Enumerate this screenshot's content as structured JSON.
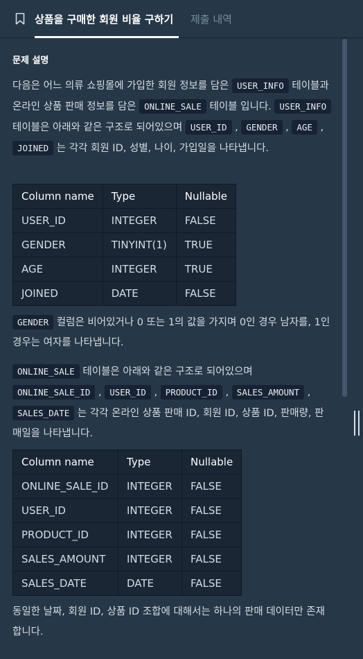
{
  "tabs": {
    "active_label": "상품을 구매한 회원 비율 구하기",
    "inactive_label": "제출 내역",
    "icon": "bookmark-icon"
  },
  "section_title": "문제 설명",
  "para1": {
    "t1": "다음은 어느 의류 쇼핑몰에 가입한 회원 정보를 담은 ",
    "c1": "USER_INFO",
    "t2": " 테이블과 온라인 상품 판매 정보를 담은 ",
    "c2": "ONLINE_SALE",
    "t3": " 테이블 입니다. ",
    "c3": "USER_INFO",
    "t4": " 테이블은 아래와 같은 구조로 되어있으며 ",
    "c4": "USER_ID",
    "t5": " , ",
    "c5": "GENDER",
    "t6": " , ",
    "c6": "AGE",
    "t7": " , ",
    "c7": "JOINED",
    "t8": " 는 각각 회원 ID, 성별, 나이, 가입일을 나타냅니다."
  },
  "table1": {
    "headers": [
      "Column name",
      "Type",
      "Nullable"
    ],
    "rows": [
      [
        "USER_ID",
        "INTEGER",
        "FALSE"
      ],
      [
        "GENDER",
        "TINYINT(1)",
        "TRUE"
      ],
      [
        "AGE",
        "INTEGER",
        "TRUE"
      ],
      [
        "JOINED",
        "DATE",
        "FALSE"
      ]
    ]
  },
  "para2": {
    "c1": "GENDER",
    "t1": " 컬럼은 비어있거나 0 또는 1의 값을 가지며 0인 경우 남자를, 1인 경우는 여자를 나타냅니다."
  },
  "para3": {
    "c1": "ONLINE_SALE",
    "t1": " 테이블은 아래와 같은 구조로 되어있으며 ",
    "c2": "ONLINE_SALE_ID",
    "t2": " , ",
    "c3": "USER_ID",
    "t3": " , ",
    "c4": "PRODUCT_ID",
    "t4": " , ",
    "c5": "SALES_AMOUNT",
    "t5": " , ",
    "c6": "SALES_DATE",
    "t6": " 는 각각 온라인 상품 판매 ID, 회원 ID, 상품 ID, 판매량, 판매일을 나타냅니다."
  },
  "table2": {
    "headers": [
      "Column name",
      "Type",
      "Nullable"
    ],
    "rows": [
      [
        "ONLINE_SALE_ID",
        "INTEGER",
        "FALSE"
      ],
      [
        "USER_ID",
        "INTEGER",
        "FALSE"
      ],
      [
        "PRODUCT_ID",
        "INTEGER",
        "FALSE"
      ],
      [
        "SALES_AMOUNT",
        "INTEGER",
        "FALSE"
      ],
      [
        "SALES_DATE",
        "DATE",
        "FALSE"
      ]
    ]
  },
  "para4": "동일한 날짜, 회원 ID, 상품 ID 조합에 대해서는 하나의 판매 데이터만 존재합니다."
}
